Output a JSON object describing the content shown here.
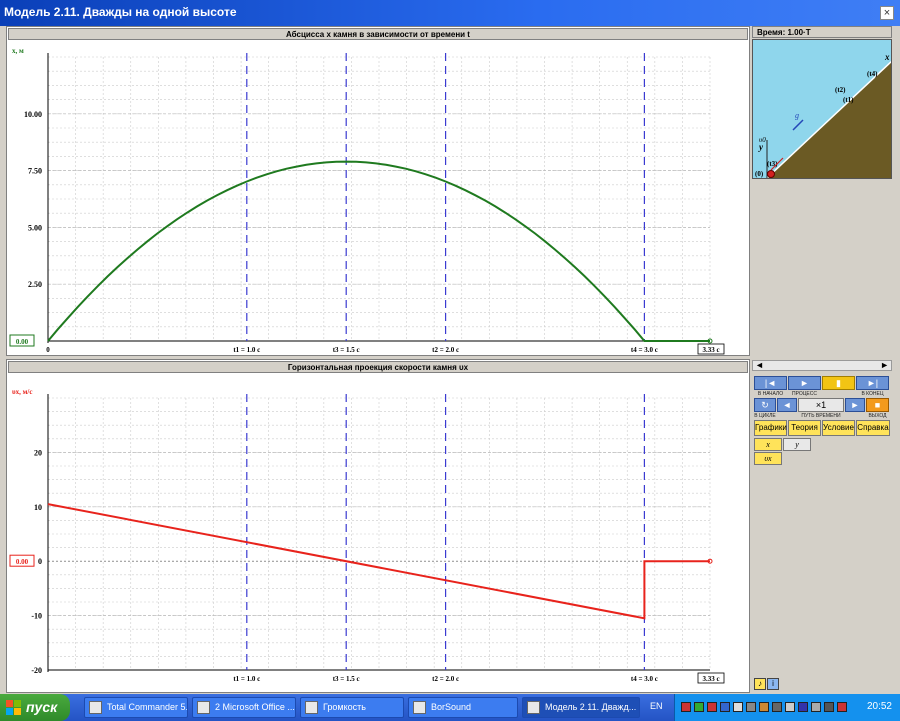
{
  "window": {
    "title": "Модель 2.11. Дважды на одной высоте",
    "close": "×"
  },
  "chart_data": [
    {
      "type": "line",
      "title": "Абсцисса x камня в зависимости от времени t",
      "ylabel": "x, м",
      "xlim": [
        0,
        3.33
      ],
      "ylim": [
        0,
        12.5
      ],
      "yticks": [
        "2.50",
        "5.00",
        "7.50",
        "10.00"
      ],
      "origin_label": "0",
      "end_label": "3.33 c",
      "cursor_value": "0.00",
      "markers": [
        {
          "t": 1.0,
          "label": "t1 = 1.0 c"
        },
        {
          "t": 1.5,
          "label": "t3 = 1.5 c"
        },
        {
          "t": 2.0,
          "label": "t2 = 2.0 c"
        },
        {
          "t": 3.0,
          "label": "t4 = 3.0 c"
        }
      ],
      "series": [
        {
          "x": [
            0,
            0.25,
            0.5,
            0.75,
            1.0,
            1.25,
            1.5,
            1.75,
            2.0,
            2.25,
            2.5,
            2.75,
            3.0,
            3.33
          ],
          "y": [
            0,
            2.32,
            4.29,
            5.89,
            7.0,
            7.65,
            7.9,
            7.65,
            7.0,
            5.89,
            4.29,
            2.32,
            0,
            0
          ]
        }
      ],
      "color": "#1f7a1f"
    },
    {
      "type": "line",
      "title": "Горизонтальная проекция скорости камня υx",
      "ylabel": "υx, м/с",
      "xlim": [
        0,
        3.33
      ],
      "ylim": [
        -20,
        30
      ],
      "yticks": [
        "-20",
        "-10",
        "0",
        "10",
        "20"
      ],
      "end_label": "3.33 c",
      "cursor_value": "0.00",
      "markers": [
        {
          "t": 1.0,
          "label": "t1 = 1.0 c"
        },
        {
          "t": 1.5,
          "label": "t3 = 1.5 c"
        },
        {
          "t": 2.0,
          "label": "t2 = 2.0 c"
        },
        {
          "t": 3.0,
          "label": "t4 = 3.0 c"
        }
      ],
      "series": [
        {
          "x": [
            0,
            3.0,
            3.0,
            3.33
          ],
          "y": [
            10.5,
            -10.5,
            0,
            0
          ]
        }
      ],
      "color": "#e8231c"
    }
  ],
  "scene": {
    "time_label": "Время: 1.00·T",
    "axis_x": "x",
    "axis_y": "y",
    "g_label": "g",
    "v0_label": "υ0",
    "points": [
      "(t4)",
      "(t2)",
      "(t1)",
      "(t3)",
      "(0)"
    ],
    "sky_color": "#8fd6ec",
    "ground_color": "#6b5a24"
  },
  "controls": {
    "transport": {
      "labels": [
        "В НАЧАЛО",
        "ПРОЦЕСС",
        "",
        "В КОНЕЦ"
      ],
      "row2_labels": [
        "В ЦИКЛЕ",
        "",
        "ПУТЬ ВРЕМЕНИ",
        "ВЫХОД"
      ],
      "speed": "×1"
    },
    "tabs": [
      "Графики",
      "Теория",
      "Условие",
      "Справка"
    ],
    "graph_tabs": [
      "x",
      "y",
      "υx"
    ]
  },
  "taskbar": {
    "start": "пуск",
    "tasks": [
      "Total Commander 5.5...",
      "2 Microsoft Office ...",
      "Громкость",
      "BorSound",
      "Модель 2.11. Дважд..."
    ],
    "lang": "EN",
    "clock": "20:52"
  }
}
